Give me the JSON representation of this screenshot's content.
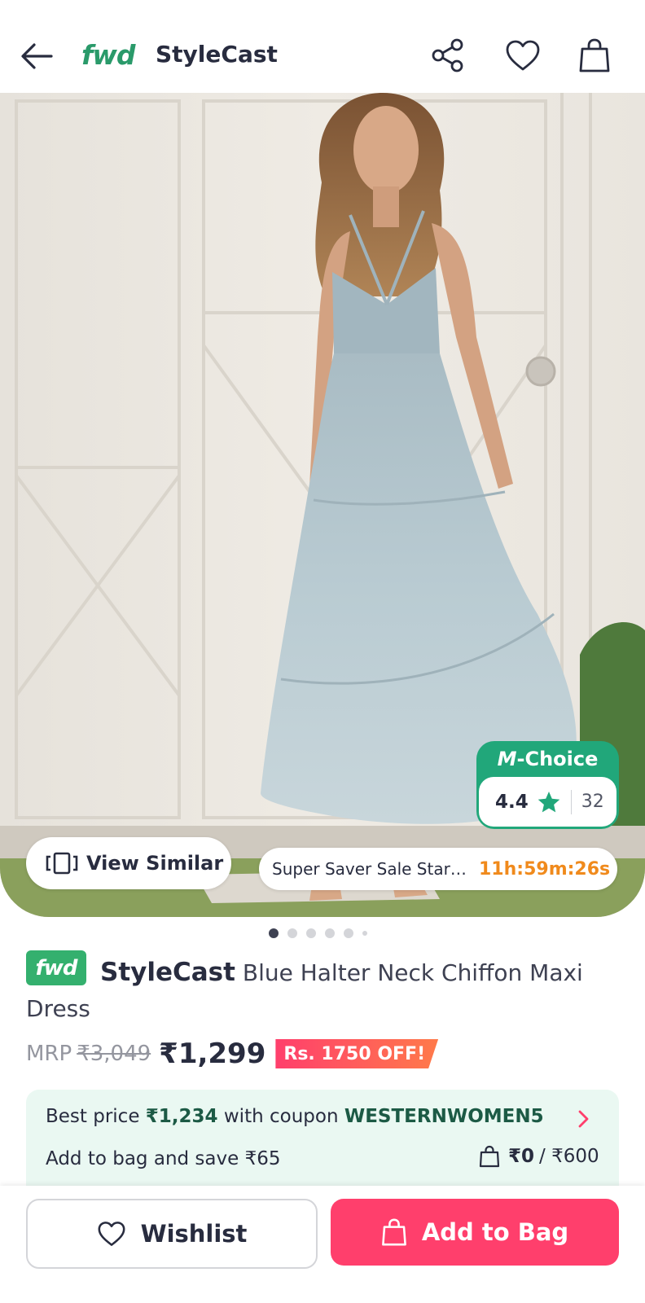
{
  "header": {
    "back_icon": "arrow-left-icon",
    "logo_text": "fwd",
    "title": "StyleCast",
    "share_icon": "share-icon",
    "wishlist_icon": "heart-icon",
    "bag_icon": "shopping-bag-icon"
  },
  "hero": {
    "mchoice_label": "-Choice",
    "mchoice_logo": "M",
    "rating": "4.4",
    "rating_count": "32",
    "view_similar_label": "View Similar",
    "sale_text": "Super Saver Sale Starts In",
    "sale_timer": "11h:59m:26s",
    "carousel": {
      "total_pages": 6,
      "current_page": 1
    }
  },
  "product": {
    "badge": "fwd",
    "brand": "StyleCast",
    "name_part1": "Blue Halter Neck Chiffon Maxi",
    "name_part2": "Dress",
    "mrp_label": "MRP",
    "mrp_value": "₹3,049",
    "price": "₹1,299",
    "discount_badge": "Rs. 1750 OFF!"
  },
  "coupon": {
    "text_before": "Best price",
    "best_price": "₹1,234",
    "text_mid": "with coupon",
    "code": "WESTERNWOMEN5",
    "save_text": "Add to bag and save ₹65",
    "bag_value": "₹0",
    "bag_threshold": "/ ₹600"
  },
  "actions": {
    "wishlist_label": "Wishlist",
    "add_to_bag_label": "Add to Bag"
  },
  "colors": {
    "brand_green": "#2a9a6a",
    "mchoice_green": "#21a77a",
    "accent_pink": "#ff3f6c",
    "timer_orange": "#f08a1c",
    "coupon_bg": "#eaf8f2"
  }
}
